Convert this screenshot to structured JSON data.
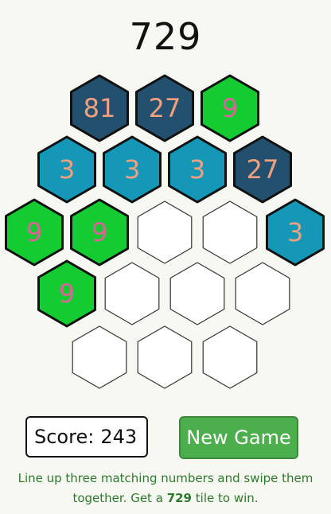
{
  "game": {
    "title": "729",
    "target": "729"
  },
  "board": {
    "rows": [
      [
        {
          "value": "81",
          "type": "navy"
        },
        {
          "value": "27",
          "type": "navy"
        },
        {
          "value": "9",
          "type": "green"
        }
      ],
      [
        {
          "value": "3",
          "type": "teal"
        },
        {
          "value": "3",
          "type": "teal"
        },
        {
          "value": "3",
          "type": "teal"
        },
        {
          "value": "27",
          "type": "navy"
        }
      ],
      [
        {
          "value": "9",
          "type": "green"
        },
        {
          "value": "9",
          "type": "green"
        },
        {
          "value": "",
          "type": "empty"
        },
        {
          "value": "",
          "type": "empty"
        },
        {
          "value": "3",
          "type": "teal"
        }
      ],
      [
        {
          "value": "9",
          "type": "green"
        },
        {
          "value": "",
          "type": "empty"
        },
        {
          "value": "",
          "type": "empty"
        },
        {
          "value": "",
          "type": "empty"
        }
      ],
      [
        {
          "value": "",
          "type": "empty"
        },
        {
          "value": "",
          "type": "empty"
        },
        {
          "value": "",
          "type": "empty"
        }
      ]
    ]
  },
  "colors": {
    "navy": "#22506e",
    "teal": "#1597b8",
    "green": "#14cc32",
    "empty": "#ffffff",
    "outline": "#111111",
    "empty_outline": "#333333",
    "text_on_green": "#e0609c",
    "text_on_blue": "#f2a07e"
  },
  "score": {
    "label": "Score:",
    "value": "243"
  },
  "controls": {
    "new_game_label": "New Game"
  },
  "instructions": {
    "before": "Line up three matching numbers and swipe them together. Get a",
    "after": "tile to win."
  }
}
